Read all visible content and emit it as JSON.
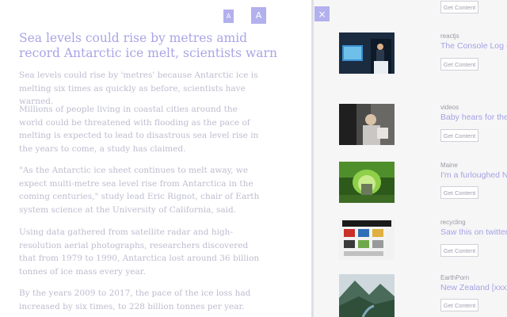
{
  "reader": {
    "font_small": "A",
    "font_large": "A",
    "title": "Sea levels could rise by metres amid record Antarctic ice melt, scientists warn",
    "paragraphs": [
      "Sea levels could rise by 'metres' because Antarctic ice is melting six times as quickly as before, scientists have warned.",
      "Millions of people living in coastal cities around the world could be threatened with flooding as the pace of melting is expected to lead to disastrous sea level rise in the years to come, a study has claimed.",
      "\"As the Antarctic ice sheet continues to melt away, we expect multi-metre sea level rise from Antarctica in the coming centuries,\" study lead Eric Rignot, chair of Earth system science at the University of California, said.",
      "Using data gathered from satellite radar and high-resolution aerial photographs, researchers discovered that from 1979 to 1990, Antarctica lost around 36 billion tonnes of ice mass every year.",
      "By the years 2009 to 2017, the pace of the ice loss had increased by six times, to 228 billion tonnes per year."
    ]
  },
  "feed": {
    "close_icon": "×",
    "top_button": "Get Content",
    "items": [
      {
        "source": "reactjs",
        "headline": "The Console Log - ",
        "button": "Get Content",
        "icon": "speaker-photo"
      },
      {
        "source": "videos",
        "headline": "Baby hears for the",
        "button": "Get Content",
        "icon": "baby-photo"
      },
      {
        "source": "Maine",
        "headline": "I'm a furloughed Na",
        "button": "Get Content",
        "icon": "tunnel-photo"
      },
      {
        "source": "recycling",
        "headline": "Saw this on twitter",
        "button": "Get Content",
        "icon": "poster-photo"
      },
      {
        "source": "EarthPorn",
        "headline": "New Zealand [xxxx",
        "button": "Get Content",
        "icon": "mountain-photo"
      }
    ]
  },
  "colors": {
    "accent": "#b3b0ee",
    "title": "#a9a5e6",
    "body_text": "#bdbdd0"
  }
}
